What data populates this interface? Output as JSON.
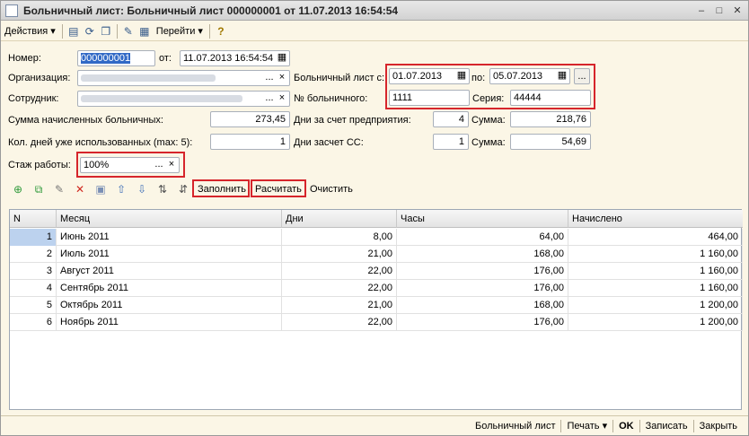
{
  "window": {
    "title": "Больничный лист: Больничный лист 000000001 от 11.07.2013 16:54:54"
  },
  "toolbar": {
    "actions_label": "Действия",
    "goto_label": "Перейти"
  },
  "form": {
    "number_label": "Номер:",
    "number_value": "000000001",
    "from_label": "от:",
    "date_value": "11.07.2013 16:54:54",
    "org_label": "Организация:",
    "sick_from_label": "Больничный лист с:",
    "sick_from_value": "01.07.2013",
    "sick_to_label": "по:",
    "sick_to_value": "05.07.2013",
    "employee_label": "Сотрудник:",
    "sick_number_label": "№ больничного:",
    "sick_number_value": "1111",
    "series_label": "Серия:",
    "series_value": "44444",
    "accrued_label": "Сумма начисленных больничных:",
    "accrued_value": "273,45",
    "employer_days_label": "Дни за счет предприятия:",
    "employer_days_value": "4",
    "employer_sum_label": "Сумма:",
    "employer_sum_value": "218,76",
    "used_days_label": "Кол. дней уже использованных (max: 5):",
    "used_days_value": "1",
    "ss_days_label": "Дни засчет СС:",
    "ss_days_value": "1",
    "ss_sum_label": "Сумма:",
    "ss_sum_value": "54,69",
    "tenure_label": "Стаж работы:",
    "tenure_value": "100%"
  },
  "grid_toolbar": {
    "fill_label": "Заполнить",
    "calc_label": "Расчитать",
    "clear_label": "Очистить"
  },
  "table": {
    "columns": [
      "N",
      "Месяц",
      "Дни",
      "Часы",
      "Начислено"
    ],
    "rows": [
      {
        "n": "1",
        "month": "Июнь 2011",
        "days": "8,00",
        "hours": "64,00",
        "accrued": "464,00"
      },
      {
        "n": "2",
        "month": "Июль 2011",
        "days": "21,00",
        "hours": "168,00",
        "accrued": "1 160,00"
      },
      {
        "n": "3",
        "month": "Август 2011",
        "days": "22,00",
        "hours": "176,00",
        "accrued": "1 160,00"
      },
      {
        "n": "4",
        "month": "Сентябрь 2011",
        "days": "22,00",
        "hours": "176,00",
        "accrued": "1 160,00"
      },
      {
        "n": "5",
        "month": "Октябрь 2011",
        "days": "21,00",
        "hours": "168,00",
        "accrued": "1 200,00"
      },
      {
        "n": "6",
        "month": "Ноябрь 2011",
        "days": "22,00",
        "hours": "176,00",
        "accrued": "1 200,00"
      }
    ]
  },
  "footer": {
    "sick_list_label": "Больничный лист",
    "print_label": "Печать",
    "ok_label": "OK",
    "save_label": "Записать",
    "close_label": "Закрыть"
  },
  "icons": {
    "ellipsis": "...",
    "clear": "×",
    "calendar": "calendar-icon"
  },
  "colors": {
    "highlight": "#d6252b",
    "selection": "#bcd2ee",
    "window_bg": "#fbf6e6"
  }
}
